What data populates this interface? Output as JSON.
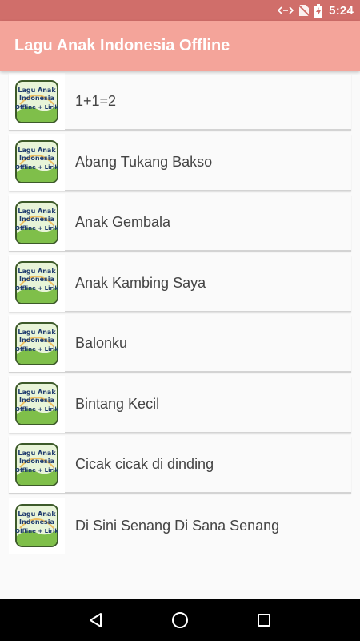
{
  "status_bar": {
    "time": "5:24"
  },
  "app_bar": {
    "title": "Lagu Anak Indonesia Offline"
  },
  "icon": {
    "line1": "Lagu Anak",
    "line2": "Indonesia",
    "line3": "Offline + Lirik"
  },
  "songs": [
    {
      "title": "1+1=2"
    },
    {
      "title": "Abang Tukang Bakso"
    },
    {
      "title": "Anak Gembala"
    },
    {
      "title": "Anak Kambing Saya"
    },
    {
      "title": "Balonku"
    },
    {
      "title": "Bintang Kecil"
    },
    {
      "title": "Cicak cicak di dinding"
    },
    {
      "title": "Di Sini Senang Di Sana Senang"
    }
  ],
  "colors": {
    "status_bar": "#d06e6a",
    "app_bar": "#f4a49a",
    "nav_bar": "#000000"
  }
}
